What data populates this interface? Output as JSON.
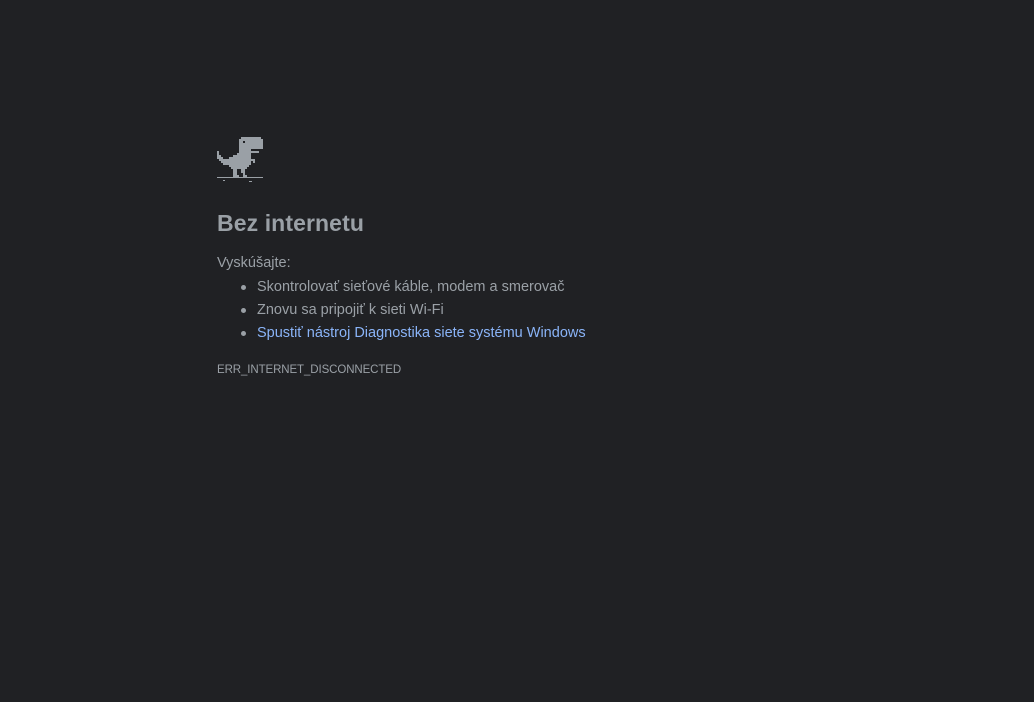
{
  "page": {
    "background": "#202124",
    "text_color": "#9aa0a6",
    "link_color": "#8ab4f8"
  },
  "icon": "offline-dino-icon",
  "title": "Bez internetu",
  "suggestions": {
    "heading": "Vyskúšajte:",
    "items": [
      {
        "label": "Skontrolovať sieťové káble, modem a smerovač",
        "is_link": false
      },
      {
        "label": "Znovu sa pripojiť k sieti Wi-Fi",
        "is_link": false
      },
      {
        "label": "Spustiť nástroj Diagnostika siete systému Windows",
        "is_link": true
      }
    ]
  },
  "error_code": "ERR_INTERNET_DISCONNECTED"
}
